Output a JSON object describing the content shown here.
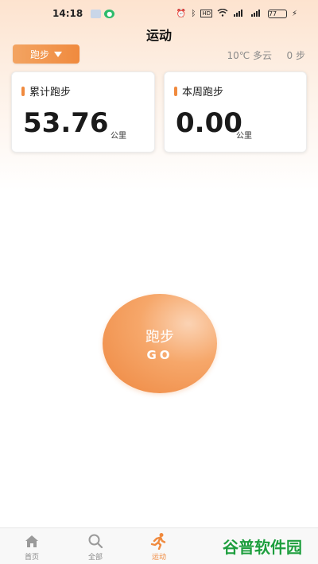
{
  "status_bar": {
    "time": "14:18",
    "network": "HD",
    "battery": "77"
  },
  "header": {
    "title": "运动",
    "sport_selector": "跑步",
    "weather": "10℃ 多云",
    "steps": "0 步"
  },
  "cards": [
    {
      "label": "累计跑步",
      "value": "53.76",
      "unit": "公里"
    },
    {
      "label": "本周跑步",
      "value": "0.00",
      "unit": "公里"
    }
  ],
  "start_button": {
    "label": "跑步",
    "sub_label": "GO"
  },
  "bottom_nav": {
    "items": [
      {
        "label": "首页",
        "icon": "home-icon"
      },
      {
        "label": "全部",
        "icon": "search-icon"
      },
      {
        "label": "运动",
        "icon": "running-icon"
      },
      {
        "label": "",
        "icon": ""
      },
      {
        "label": "",
        "icon": ""
      }
    ],
    "active_index": 2
  },
  "watermark": "谷普软件园",
  "colors": {
    "accent": "#f08a3e",
    "inactive": "#8a8a8a"
  }
}
